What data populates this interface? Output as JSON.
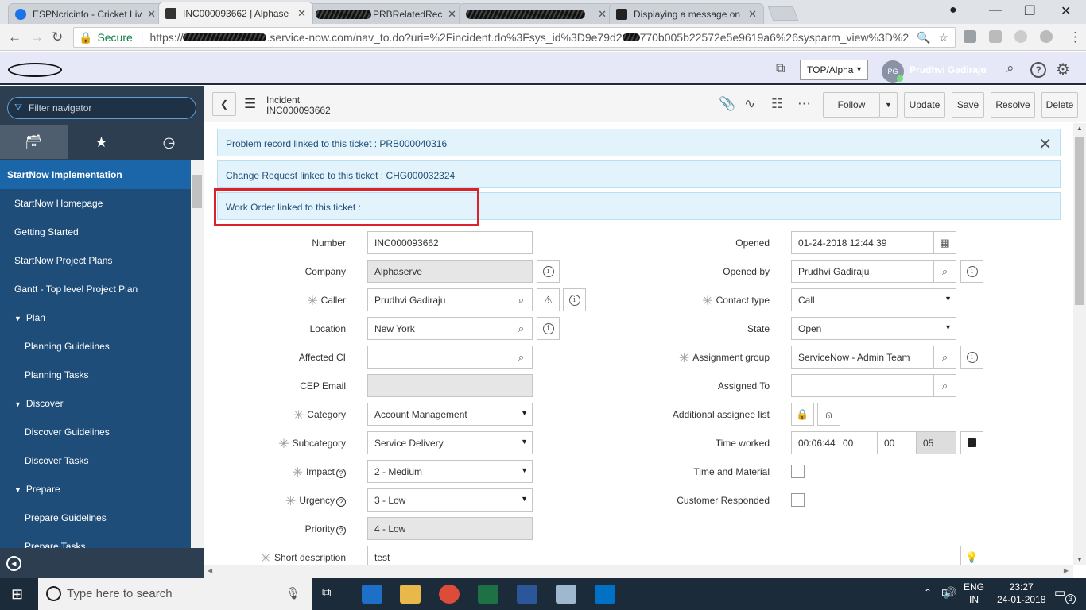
{
  "browser": {
    "tabs": [
      {
        "title": "ESPNcricinfo - Cricket Liv",
        "color": "#1a73e8"
      },
      {
        "title": "INC000093662 | Alphase",
        "color": "#333333"
      },
      {
        "title": "PRBRelatedRec",
        "color": "#555555"
      },
      {
        "title": "",
        "color": "#555555"
      },
      {
        "title": "Displaying a message on",
        "color": "#222222"
      }
    ],
    "secure_label": "Secure",
    "url_prefix": "https://",
    "url_main": ".service-now.com/nav_to.do?uri=%2Fincident.do%3Fsys_id%3D9e79d2",
    "url_suffix": "770b005b22572e5e9619a6%26sysparm_view%3D%26sys..."
  },
  "sn_header": {
    "scope": "TOP/Alpha",
    "user_initials": "PG",
    "user_name": "Prudhvi Gadiraju"
  },
  "nav": {
    "filter_placeholder": "Filter navigator",
    "items": [
      {
        "label": "StartNow Implementation",
        "kind": "app"
      },
      {
        "label": "StartNow Homepage",
        "kind": "l1"
      },
      {
        "label": "Getting Started",
        "kind": "l1"
      },
      {
        "label": "StartNow Project Plans",
        "kind": "l1"
      },
      {
        "label": "Gantt - Top level Project Plan",
        "kind": "l1"
      },
      {
        "label": "Plan",
        "kind": "grp"
      },
      {
        "label": "Planning Guidelines",
        "kind": "l2"
      },
      {
        "label": "Planning Tasks",
        "kind": "l2"
      },
      {
        "label": "Discover",
        "kind": "grp"
      },
      {
        "label": "Discover Guidelines",
        "kind": "l2"
      },
      {
        "label": "Discover Tasks",
        "kind": "l2"
      },
      {
        "label": "Prepare",
        "kind": "grp"
      },
      {
        "label": "Prepare Guidelines",
        "kind": "l2"
      },
      {
        "label": "Prepare Tasks",
        "kind": "l2"
      }
    ]
  },
  "form_header": {
    "table": "Incident",
    "number": "INC000093662",
    "buttons": [
      "Follow",
      "Update",
      "Save",
      "Resolve",
      "Delete"
    ]
  },
  "messages": [
    "Problem record linked to this ticket : PRB000040316",
    "Change Request linked to this ticket : CHG000032324",
    "Work Order linked to this ticket :"
  ],
  "form": {
    "left": [
      {
        "label": "Number",
        "value": "INC000093662"
      },
      {
        "label": "Company",
        "value": "Alphaserve"
      },
      {
        "label": "Caller",
        "value": "Prudhvi Gadiraju"
      },
      {
        "label": "Location",
        "value": "New York"
      },
      {
        "label": "Affected CI",
        "value": ""
      },
      {
        "label": "CEP Email",
        "value": ""
      },
      {
        "label": "Category",
        "value": "Account Management"
      },
      {
        "label": "Subcategory",
        "value": "Service Delivery"
      },
      {
        "label": "Impact",
        "value": "2 - Medium"
      },
      {
        "label": "Urgency",
        "value": "3 - Low"
      },
      {
        "label": "Priority",
        "value": "4 - Low"
      },
      {
        "label": "Short description",
        "value": "test"
      }
    ],
    "right": [
      {
        "label": "Opened",
        "value": "01-24-2018 12:44:39"
      },
      {
        "label": "Opened by",
        "value": "Prudhvi Gadiraju"
      },
      {
        "label": "Contact type",
        "value": "Call"
      },
      {
        "label": "State",
        "value": "Open"
      },
      {
        "label": "Assignment group",
        "value": "ServiceNow - Admin Team"
      },
      {
        "label": "Assigned To",
        "value": ""
      },
      {
        "label": "Additional assignee list",
        "value": ""
      },
      {
        "label": "Time worked",
        "value": ""
      },
      {
        "label": "Time and Material",
        "value": ""
      },
      {
        "label": "Customer Responded",
        "value": ""
      }
    ],
    "time_worked": {
      "timer": "00:06:44",
      "hours": "00",
      "minutes": "00",
      "seconds": "05"
    }
  },
  "taskbar": {
    "search_placeholder": "Type here to search",
    "lang1": "ENG",
    "lang2": "IN",
    "time": "23:27",
    "date": "24-01-2018",
    "notifications": "3"
  }
}
